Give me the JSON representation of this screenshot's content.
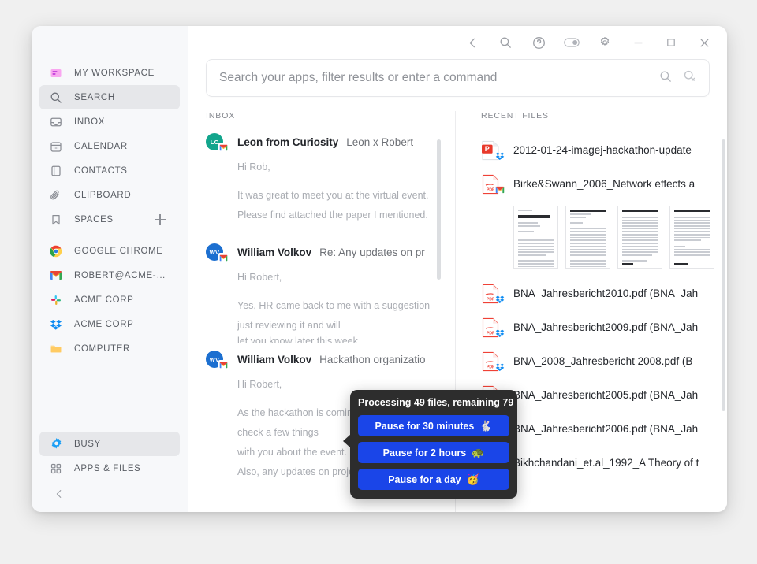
{
  "sidebar": {
    "top_items": [
      {
        "label": "MY WORKSPACE",
        "icon": "workspace-icon"
      },
      {
        "label": "SEARCH",
        "icon": "search-icon"
      },
      {
        "label": "INBOX",
        "icon": "inbox-icon"
      },
      {
        "label": "CALENDAR",
        "icon": "calendar-icon"
      },
      {
        "label": "CONTACTS",
        "icon": "contacts-icon"
      },
      {
        "label": "CLIPBOARD",
        "icon": "clipboard-icon"
      },
      {
        "label": "SPACES",
        "icon": "bookmark-icon"
      }
    ],
    "apps": [
      {
        "label": "GOOGLE CHROME",
        "icon": "chrome-icon"
      },
      {
        "label": "ROBERT@ACME-…",
        "icon": "gmail-icon"
      },
      {
        "label": "ACME CORP",
        "icon": "slack-icon"
      },
      {
        "label": "ACME CORP",
        "icon": "dropbox-icon"
      },
      {
        "label": "COMPUTER",
        "icon": "folder-icon"
      }
    ],
    "bottom_items": [
      {
        "label": "BUSY",
        "icon": "gear-busy-icon"
      },
      {
        "label": "APPS & FILES",
        "icon": "grid-icon"
      }
    ],
    "selected": "SEARCH",
    "selected_bottom": "BUSY",
    "add_space_label": "+"
  },
  "titlebar": {
    "buttons": [
      {
        "name": "back-button",
        "icon": "chevron-left-icon"
      },
      {
        "name": "search-button",
        "icon": "search-icon"
      },
      {
        "name": "help-button",
        "icon": "question-circle-icon"
      },
      {
        "name": "toggle-button",
        "icon": "toggle-icon"
      },
      {
        "name": "settings-button",
        "icon": "gear-icon"
      },
      {
        "name": "minimize-button",
        "icon": "minimize-icon"
      },
      {
        "name": "maximize-button",
        "icon": "maximize-icon"
      },
      {
        "name": "close-button",
        "icon": "close-icon"
      }
    ]
  },
  "search": {
    "value": "",
    "placeholder": "Search your apps, filter results or enter a command"
  },
  "inbox": {
    "title": "INBOX",
    "messages": [
      {
        "initials": "LC",
        "avatar_color": "#12a58c",
        "source": "gmail-icon",
        "sender": "Leon from Curiosity",
        "subject": "Leon x Robert",
        "lines": [
          "Hi Rob,",
          "",
          "It was great to meet you at the virtual event.",
          "Please find attached the paper I mentioned."
        ]
      },
      {
        "initials": "WV",
        "avatar_color": "#1c6fd0",
        "source": "gmail-icon",
        "sender": "William Volkov",
        "subject": "Re: Any updates on pr",
        "lines": [
          "Hi Robert,",
          "",
          "Yes, HR came back to me with a suggestion. I'm",
          "just reviewing it and will",
          "let you know later this week."
        ]
      },
      {
        "initials": "WV",
        "avatar_color": "#1c6fd0",
        "source": "gmail-icon",
        "sender": "William Volkov",
        "subject": "Hackathon organizatio",
        "lines": [
          "Hi Robert,",
          "",
          "As the hackathon is coming closer, I wanted to",
          "check a few things",
          "with you about the event.",
          "",
          "Also, any updates on projec"
        ]
      }
    ]
  },
  "recent_files": {
    "title": "RECENT FILES",
    "files": [
      {
        "name": "2012-01-24-imagej-hackathon-update",
        "type": "ppt",
        "source": "dropbox-icon",
        "has_preview": false
      },
      {
        "name": "Birke&Swann_2006_Network effects a",
        "type": "pdf",
        "source": "gmail-icon",
        "has_preview": true
      },
      {
        "name": "BNA_Jahresbericht2010.pdf (BNA_Jah",
        "type": "pdf",
        "source": "dropbox-icon",
        "has_preview": false
      },
      {
        "name": "BNA_Jahresbericht2009.pdf (BNA_Jah",
        "type": "pdf",
        "source": "dropbox-icon",
        "has_preview": false
      },
      {
        "name": "BNA_2008_Jahresbericht 2008.pdf (B",
        "type": "pdf",
        "source": "dropbox-icon",
        "has_preview": false
      },
      {
        "name": "BNA_Jahresbericht2005.pdf (BNA_Jah",
        "type": "pdf",
        "source": "dropbox-icon",
        "has_preview": false
      },
      {
        "name": "BNA_Jahresbericht2006.pdf (BNA_Jah",
        "type": "pdf",
        "source": "dropbox-icon",
        "has_preview": false
      },
      {
        "name": "Bikhchandani_et.al_1992_A Theory of t",
        "type": "pdf",
        "source": "dropbox-icon",
        "has_preview": false
      }
    ]
  },
  "popover": {
    "title": "Processing 49 files, remaining 79",
    "buttons": [
      {
        "label": "Pause for 30 minutes",
        "emoji": "🐇"
      },
      {
        "label": "Pause for 2 hours",
        "emoji": "🐢"
      },
      {
        "label": "Pause for a day",
        "emoji": "🥳"
      }
    ],
    "accent_color": "#1a45e8",
    "background_color": "#2d2d2d"
  }
}
